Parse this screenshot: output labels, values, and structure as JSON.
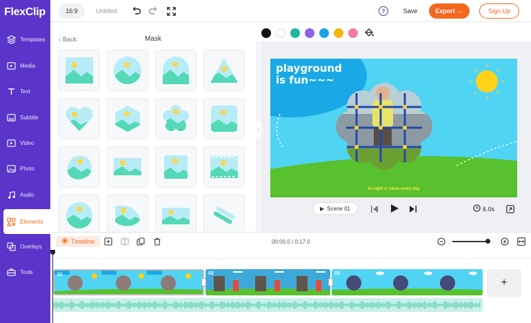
{
  "app": {
    "name": "FlexClip",
    "logo_first": "F",
    "logo_rest": "lexClip"
  },
  "topbar": {
    "ratio": "16:9",
    "project_title": "Untitled",
    "save_label": "Save",
    "export_label": "Export",
    "signup_label": "Sign Up"
  },
  "sidebar": {
    "items": [
      {
        "label": "Templates",
        "icon": "layers-icon"
      },
      {
        "label": "Media",
        "icon": "media-icon"
      },
      {
        "label": "Text",
        "icon": "text-icon"
      },
      {
        "label": "Subtitle",
        "icon": "subtitle-icon"
      },
      {
        "label": "Video",
        "icon": "video-icon"
      },
      {
        "label": "Photo",
        "icon": "photo-icon"
      },
      {
        "label": "Audio",
        "icon": "music-icon"
      },
      {
        "label": "Elements",
        "icon": "elements-icon",
        "active": true
      },
      {
        "label": "Overlays",
        "icon": "overlays-icon"
      },
      {
        "label": "Tools",
        "icon": "tools-icon"
      }
    ]
  },
  "panel": {
    "back_label": "Back",
    "title": "Mask",
    "masks": [
      "square",
      "circle",
      "arch",
      "triangle",
      "heart",
      "hexagon",
      "flower",
      "rounded-square",
      "blob",
      "wave-rect",
      "soft-square",
      "film-strip",
      "circle-2",
      "leaf",
      "rectangle",
      "tilted-stack"
    ]
  },
  "colors": {
    "swatches": [
      "#111111",
      "#ffffff",
      "#1fb6a0",
      "#8e63e8",
      "#1ea3e8",
      "#f7b516",
      "#f27ba6"
    ],
    "accent": "#f5671d",
    "brand": "#5b34c9"
  },
  "preview": {
    "headline_line1": "playground",
    "headline_line2": "is fun~~~",
    "caption": "At eight o 'clock every day",
    "scene_label": "Scene 01",
    "duration": "6.0s"
  },
  "timeline": {
    "label": "Timeline",
    "time": "00:00.0 / 0:17.0",
    "clips": [
      {
        "num": "01"
      },
      {
        "num": "02"
      },
      {
        "num": "03"
      }
    ],
    "add_label": "+"
  }
}
